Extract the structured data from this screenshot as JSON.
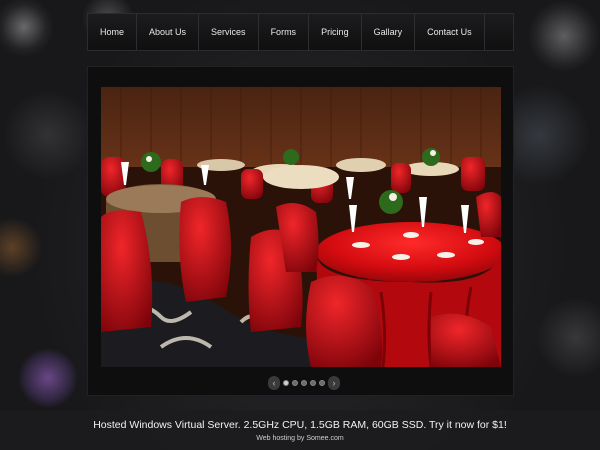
{
  "nav": {
    "items": [
      {
        "label": "Home"
      },
      {
        "label": "About Us"
      },
      {
        "label": "Services"
      },
      {
        "label": "Forms"
      },
      {
        "label": "Pricing"
      },
      {
        "label": "Gallary"
      },
      {
        "label": "Contact Us"
      }
    ]
  },
  "slider": {
    "image": "banquet-hall-red-table-setting",
    "dot_count": 5,
    "active_dot": 1,
    "prev_icon": "chevron-left-icon",
    "next_icon": "chevron-right-icon"
  },
  "footer": {
    "ad_text": "Hosted Windows Virtual Server. 2.5GHz CPU, 1.5GB RAM, 60GB SSD. Try it now for $1!",
    "host_text": "Web hosting by Somee.com"
  }
}
